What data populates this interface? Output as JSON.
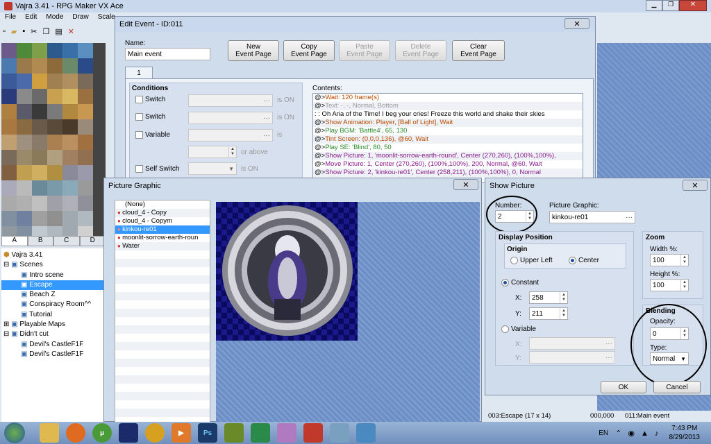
{
  "main": {
    "title": "Vajra 3.41 - RPG Maker VX Ace",
    "menu": [
      "File",
      "Edit",
      "Mode",
      "Draw",
      "Scale"
    ],
    "tileset_tabs": [
      "A",
      "B",
      "C",
      "D"
    ],
    "tree": {
      "root": "Vajra 3.41",
      "folders": [
        {
          "label": "Scenes",
          "children": [
            "Intro scene",
            "Escape",
            "Beach Z",
            "Conspiracy Room^^",
            "Tutorial"
          ]
        },
        {
          "label": "Playable Maps",
          "children": []
        },
        {
          "label": "Didn't cut",
          "children": [
            "Devil's CastleF1F",
            "Devil's CastleF1F"
          ]
        }
      ]
    },
    "status": [
      "003:Escape (17 x 14)",
      "000,000",
      "011:Main event"
    ]
  },
  "edit_event": {
    "title": "Edit Event - ID:011",
    "name_label": "Name:",
    "name_value": "Main event",
    "buttons": {
      "new": "New\nEvent Page",
      "copy": "Copy\nEvent Page",
      "paste": "Paste\nEvent Page",
      "delete": "Delete\nEvent Page",
      "clear": "Clear\nEvent Page"
    },
    "page_tab": "1",
    "conditions_label": "Conditions",
    "switch1": "Switch",
    "switch2": "Switch",
    "variable": "Variable",
    "self_switch": "Self Switch",
    "is_on1": "is ON",
    "is_on2": "is ON",
    "is_label": "is",
    "or_above": "or above",
    "is_on3": "is ON",
    "contents_label": "Contents:",
    "commands": [
      {
        "p": "@>",
        "t": "Wait: 120 frame(s)",
        "c": "#b94a00"
      },
      {
        "p": "@>",
        "t": "Text: -, -, Normal, Bottom",
        "c": "#9a9a9a"
      },
      {
        "p": " : ",
        "t": "        : Oh Aria of the Time! I beg your cries! Freeze this world and shake their skies",
        "c": "#000"
      },
      {
        "p": "@>",
        "t": "Show Animation: Player, [Ball of Light], Wait",
        "c": "#b94a00"
      },
      {
        "p": "@>",
        "t": "Play BGM: 'Battle4', 65, 130",
        "c": "#2a8a2a"
      },
      {
        "p": "@>",
        "t": "Tint Screen: (0,0,0,136), @60, Wait",
        "c": "#b94a00"
      },
      {
        "p": "@>",
        "t": "Play SE: 'Blind', 80, 50",
        "c": "#2a8a2a"
      },
      {
        "p": "@>",
        "t": "Show Picture: 1, 'moonlit-sorrow-earth-round', Center (270,260), (100%,100%),",
        "c": "#8a1a8a"
      },
      {
        "p": "@>",
        "t": "Move Picture: 1, Center (270,260), (100%,100%), 200, Normal, @60, Wait",
        "c": "#8a1a8a"
      },
      {
        "p": "@>",
        "t": "Show Picture: 2, 'kinkou-re01', Center (258,211), (100%,100%), 0, Normal",
        "c": "#8a1a8a"
      }
    ]
  },
  "picture_graphic": {
    "title": "Picture Graphic",
    "items": [
      "(None)",
      "cloud_4 - Copy",
      "cloud_4 - Copym",
      "kinkou-re01",
      "moonlit-sorrow-earth-roun",
      "Water"
    ],
    "selected": 3
  },
  "show_picture": {
    "title": "Show Picture",
    "number_label": "Number:",
    "number_value": "2",
    "graphic_label": "Picture Graphic:",
    "graphic_value": "kinkou-re01",
    "display_position": "Display Position",
    "origin": "Origin",
    "upper_left": "Upper Left",
    "center": "Center",
    "constant": "Constant",
    "x_label": "X:",
    "x_value": "258",
    "y_label": "Y:",
    "y_value": "211",
    "variable": "Variable",
    "vx": "X:",
    "vy": "Y:",
    "zoom": "Zoom",
    "width_label": "Width %:",
    "width_value": "100",
    "height_label": "Height %:",
    "height_value": "100",
    "blending": "Blending",
    "opacity_label": "Opacity:",
    "opacity_value": "0",
    "type_label": "Type:",
    "type_value": "Normal",
    "ok": "OK",
    "cancel": "Cancel"
  },
  "taskbar": {
    "lang": "EN",
    "time": "7:43 PM",
    "date": "8/29/2013",
    "apps": [
      "Ps"
    ]
  },
  "colors": {
    "selection": "#3399ff",
    "desktop": "#5a7fb5"
  }
}
